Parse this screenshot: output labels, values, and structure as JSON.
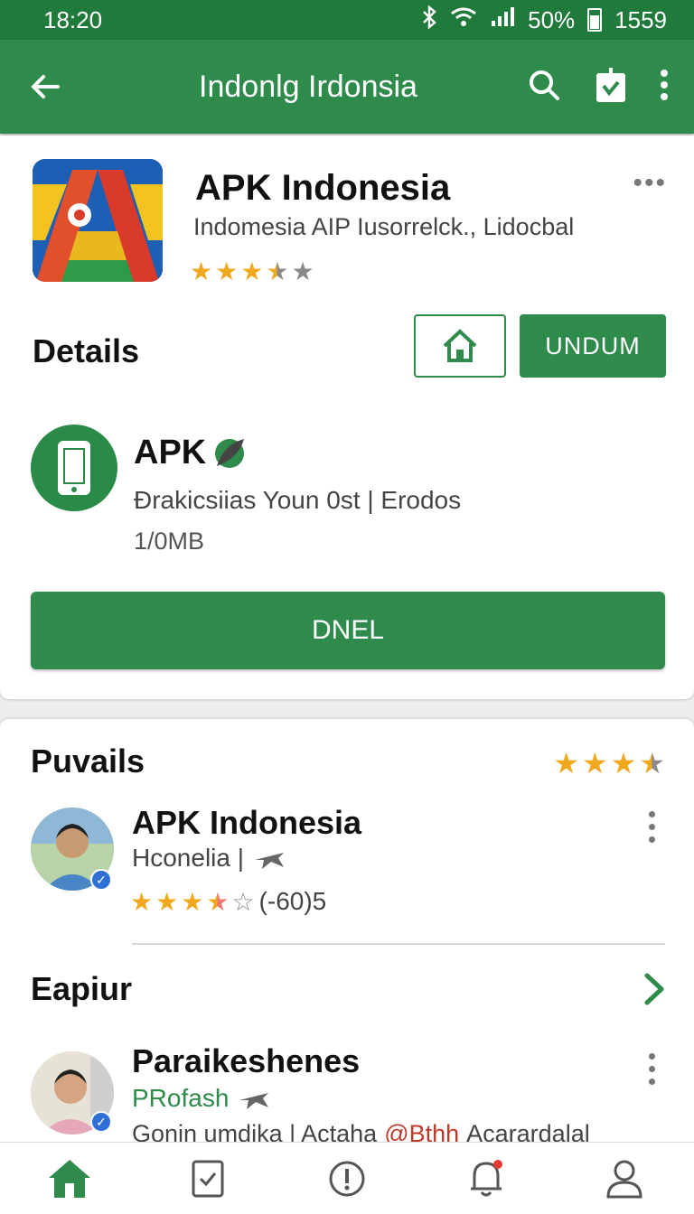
{
  "status": {
    "time": "18:20",
    "battery": "50%",
    "extra": "1559"
  },
  "appbar": {
    "title": "Indonlg Irdonsia"
  },
  "app": {
    "name": "APK Indonesia",
    "subtitle": "Indomesia AIP Iusorrelck., Lidocbal",
    "rating": 3.5
  },
  "details": {
    "heading": "Details",
    "undum_label": "UNDUM"
  },
  "apk": {
    "title": "APK",
    "meta": "Đrakicsiias Youn 0st | Erodos",
    "size": "1/0MB"
  },
  "primary_button": "DNEL",
  "reviews": {
    "heading": "Puvails",
    "rating": 3.5,
    "items": [
      {
        "name": "APK Indonesia",
        "sub": "Hconelia |",
        "count": "(-60)5",
        "rating": 3.5
      }
    ]
  },
  "section2": {
    "heading": "Eapiur",
    "items": [
      {
        "name": "Paraikeshenes",
        "sub": "PRofash",
        "meta": "Gonin umdika | Actaha",
        "highlight": "@Bthh",
        "meta2": "Acarardalal"
      }
    ]
  },
  "colors": {
    "primary": "#2e8b4b",
    "statusbar": "#1f7a3c",
    "star": "#f0a81e",
    "highlight": "#c0392b"
  },
  "bottom_nav": [
    "home-icon",
    "task-icon",
    "info-icon",
    "notification-icon",
    "profile-icon"
  ]
}
